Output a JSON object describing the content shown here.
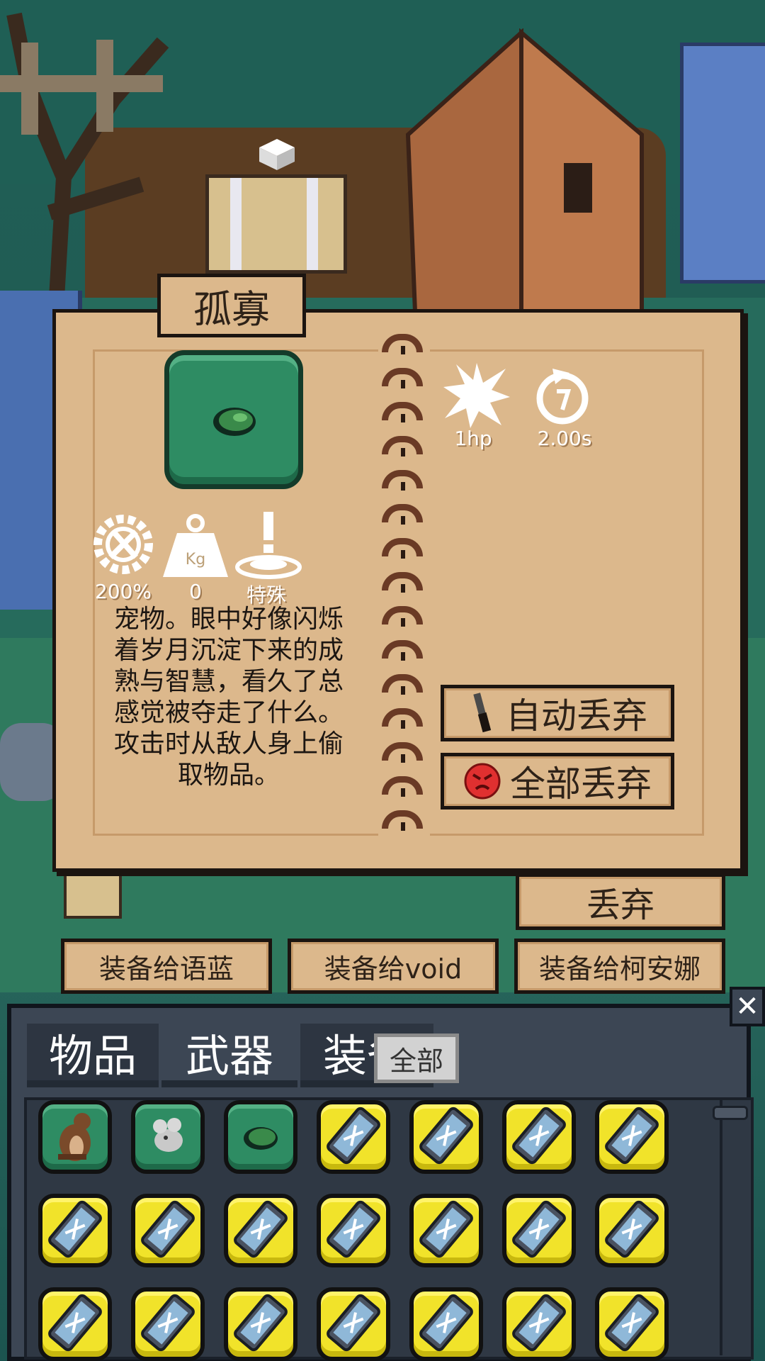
{
  "item": {
    "name": "孤寡",
    "icon": "green-slime-pet-icon",
    "attack_value": "1hp",
    "attack_icon": "burst-icon",
    "cooldown_value": "2.00s",
    "cooldown_icon": "cooldown-clock-icon",
    "proficiency_value": "200%",
    "proficiency_icon": "gear-tools-icon",
    "weight_value": "0",
    "weight_icon": "kg-weight-icon",
    "type_value": "特殊",
    "type_icon": "special-alert-icon",
    "description_lines": [
      "宠物。眼中好像闪烁",
      "着岁月沉淀下来的成",
      "熟与智慧，看久了总",
      "感觉被夺走了什么。",
      "攻击时从敌人身上偷",
      "取物品。"
    ]
  },
  "actions": {
    "auto_discard": "自动丢弃",
    "discard_all": "全部丢弃",
    "discard": "丢弃",
    "equip_1": "装备给语蓝",
    "equip_2": "装备给void",
    "equip_3": "装备给柯安娜"
  },
  "inventory": {
    "tabs": [
      "物品",
      "武器",
      "装备"
    ],
    "filter_label": "全部",
    "close_label": "✕",
    "slots": [
      {
        "kind": "green",
        "icon": "otter-pet-icon"
      },
      {
        "kind": "green",
        "icon": "mouse-pet-icon"
      },
      {
        "kind": "green",
        "icon": "green-slime-pet-icon"
      },
      {
        "kind": "yellow",
        "icon": "battery-cell-icon"
      },
      {
        "kind": "yellow",
        "icon": "battery-cell-icon"
      },
      {
        "kind": "yellow",
        "icon": "battery-cell-icon"
      },
      {
        "kind": "yellow",
        "icon": "battery-cell-icon"
      },
      {
        "kind": "yellow",
        "icon": "battery-cell-icon"
      },
      {
        "kind": "yellow",
        "icon": "battery-cell-icon"
      },
      {
        "kind": "yellow",
        "icon": "battery-cell-icon"
      },
      {
        "kind": "yellow",
        "icon": "battery-cell-icon"
      },
      {
        "kind": "yellow",
        "icon": "battery-cell-icon"
      },
      {
        "kind": "yellow",
        "icon": "battery-cell-icon"
      },
      {
        "kind": "yellow",
        "icon": "battery-cell-icon"
      },
      {
        "kind": "yellow",
        "icon": "battery-cell-icon"
      },
      {
        "kind": "yellow",
        "icon": "battery-cell-icon"
      },
      {
        "kind": "yellow",
        "icon": "battery-cell-icon"
      },
      {
        "kind": "yellow",
        "icon": "battery-cell-icon"
      },
      {
        "kind": "yellow",
        "icon": "battery-cell-icon"
      },
      {
        "kind": "yellow",
        "icon": "battery-cell-icon"
      },
      {
        "kind": "yellow",
        "icon": "battery-cell-icon"
      }
    ]
  },
  "colors": {
    "paper": "#dcb88c",
    "ink": "#1b1410",
    "slot_green": "#2e8c63",
    "slot_yellow": "#f1e32a",
    "panel_dark": "#3c4654"
  }
}
